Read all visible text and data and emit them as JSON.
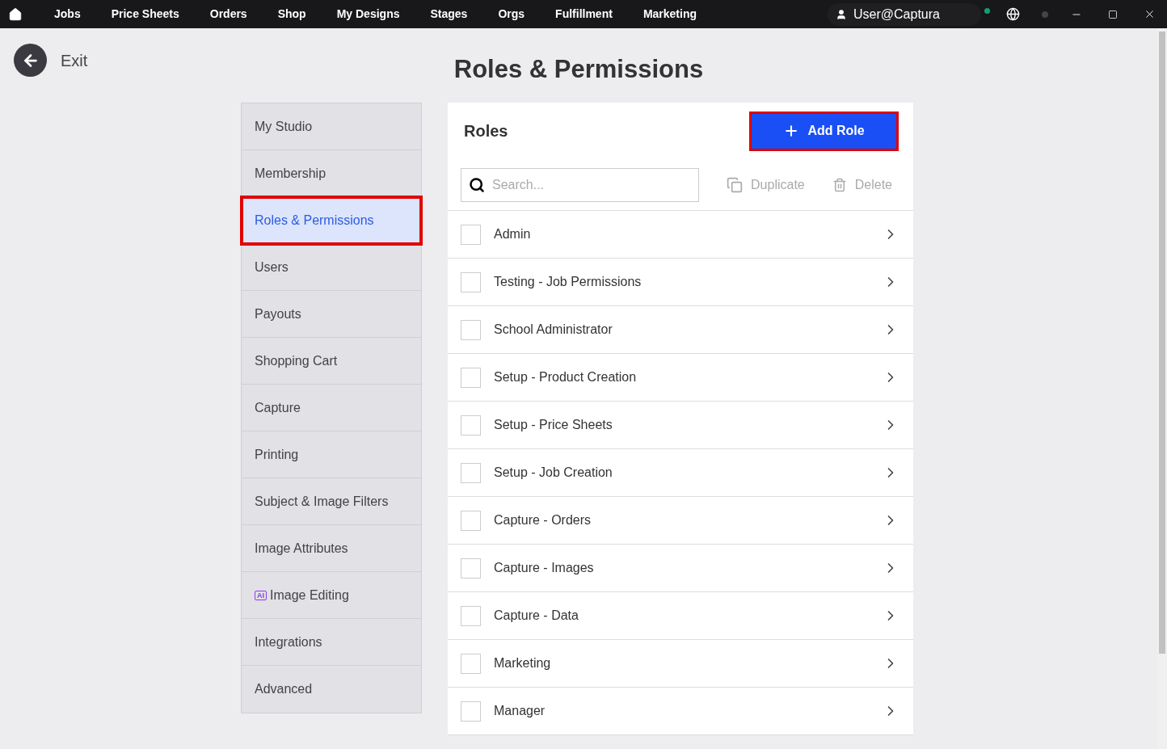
{
  "top_nav": {
    "items": [
      "Jobs",
      "Price Sheets",
      "Orders",
      "Shop",
      "My Designs",
      "Stages",
      "Orgs",
      "Fulfillment",
      "Marketing"
    ],
    "user": "User@Captura",
    "online": true
  },
  "exit": {
    "label": "Exit"
  },
  "page_title": "Roles & Permissions",
  "sidebar": {
    "items": [
      {
        "label": "My Studio",
        "selected": false,
        "highlighted": false
      },
      {
        "label": "Membership",
        "selected": false,
        "highlighted": false
      },
      {
        "label": "Roles & Permissions",
        "selected": true,
        "highlighted": true
      },
      {
        "label": "Users",
        "selected": false,
        "highlighted": false
      },
      {
        "label": "Payouts",
        "selected": false,
        "highlighted": false
      },
      {
        "label": "Shopping Cart",
        "selected": false,
        "highlighted": false
      },
      {
        "label": "Capture",
        "selected": false,
        "highlighted": false
      },
      {
        "label": "Printing",
        "selected": false,
        "highlighted": false
      },
      {
        "label": "Subject & Image Filters",
        "selected": false,
        "highlighted": false
      },
      {
        "label": "Image Attributes",
        "selected": false,
        "highlighted": false
      },
      {
        "label": "Image Editing",
        "badge": "AI",
        "selected": false,
        "highlighted": false
      },
      {
        "label": "Integrations",
        "selected": false,
        "highlighted": false
      },
      {
        "label": "Advanced",
        "selected": false,
        "highlighted": false
      }
    ]
  },
  "roles_panel": {
    "title": "Roles",
    "add_button": {
      "label": "Add Role",
      "highlighted": true
    },
    "search": {
      "placeholder": "Search..."
    },
    "actions": [
      {
        "kind": "duplicate",
        "label": "Duplicate",
        "disabled": true
      },
      {
        "kind": "delete",
        "label": "Delete",
        "disabled": true
      }
    ],
    "rows": [
      {
        "name": "Admin",
        "checked": false
      },
      {
        "name": "Testing - Job Permissions",
        "checked": false
      },
      {
        "name": "School Administrator",
        "checked": false
      },
      {
        "name": "Setup - Product Creation",
        "checked": false
      },
      {
        "name": "Setup - Price Sheets",
        "checked": false
      },
      {
        "name": "Setup - Job Creation",
        "checked": false
      },
      {
        "name": "Capture - Orders",
        "checked": false
      },
      {
        "name": "Capture - Images",
        "checked": false
      },
      {
        "name": "Capture - Data",
        "checked": false
      },
      {
        "name": "Marketing",
        "checked": false
      },
      {
        "name": "Manager",
        "checked": false
      }
    ]
  }
}
